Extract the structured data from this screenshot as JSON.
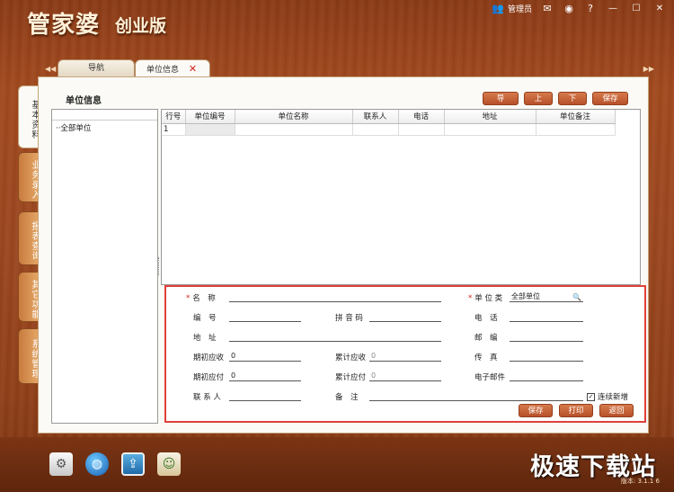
{
  "app": {
    "title": "管家婆",
    "edition": "创业版"
  },
  "topbar": {
    "user": "管理员"
  },
  "tabs": [
    {
      "label": "导航"
    },
    {
      "label": "单位信息"
    }
  ],
  "sidebar": {
    "items": [
      {
        "label": "基本资料"
      },
      {
        "label": "业务录入"
      },
      {
        "label": "报表查询"
      },
      {
        "label": "其它功能"
      },
      {
        "label": "系统管理"
      }
    ]
  },
  "main": {
    "title": "单位信息",
    "actions": {
      "import": "导入...",
      "up": "上移",
      "down": "下移",
      "save_order": "保存排序"
    },
    "tree": {
      "root": "全部单位"
    },
    "grid": {
      "columns": [
        "行号",
        "单位编号",
        "单位名称",
        "联系人",
        "电话",
        "地址",
        "单位备注"
      ],
      "rows": [
        [
          "1",
          "",
          "",
          "",
          "",
          "",
          ""
        ]
      ]
    }
  },
  "form": {
    "name_label": "名　称",
    "code_label": "编　号",
    "pinyin_label": "拼 音 码",
    "address_label": "地　址",
    "init_recv_label": "期初应收",
    "init_recv_value": "0",
    "total_recv_label": "累计应收",
    "total_recv_value": "0",
    "init_pay_label": "期初应付",
    "init_pay_value": "0",
    "total_pay_label": "累计应付",
    "total_pay_value": "0",
    "contact_label": "联 系 人",
    "remark_label": "备　注",
    "unit_class_label": "单 位 类",
    "unit_class_value": "全部单位",
    "phone_label": "电　话",
    "postcode_label": "邮　编",
    "fax_label": "传　真",
    "email_label": "电子邮件",
    "continuous_label": "连续新增",
    "save": "保存",
    "print": "打印",
    "back": "返回"
  },
  "footer": {
    "watermark": "极速下载站",
    "version": "版本: 3.1.1 6"
  }
}
